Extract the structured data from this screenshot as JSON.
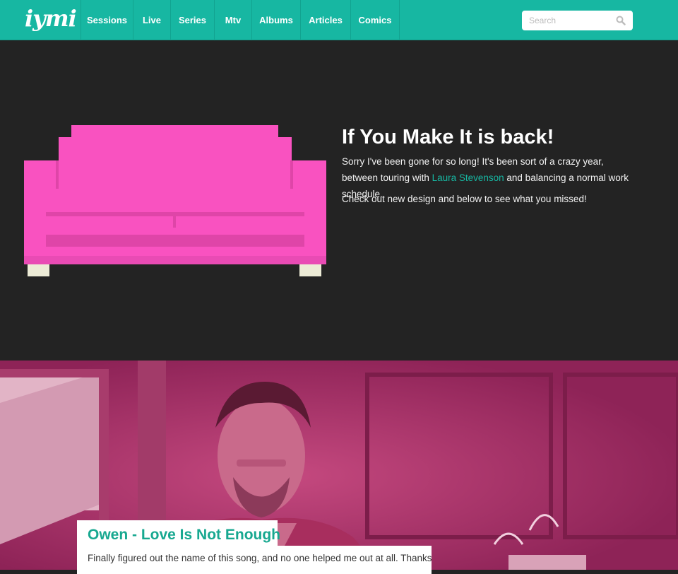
{
  "nav": {
    "logo": "iymi",
    "items": [
      {
        "label": "Sessions"
      },
      {
        "label": "Live"
      },
      {
        "label": "Series"
      },
      {
        "label": "Mtv"
      },
      {
        "label": "Albums"
      },
      {
        "label": "Articles"
      },
      {
        "label": "Comics"
      }
    ],
    "search_placeholder": "Search"
  },
  "hero": {
    "title": "If You Make It is back!",
    "p1_before": "Sorry I've been gone for so long! It's been sort of a crazy year, between touring with ",
    "p1_link": "Laura Stevenson",
    "p1_after": " and balancing a normal work schedule.",
    "p2": "Check out new design and below to see what you missed!"
  },
  "feature": {
    "title": "Owen - Love Is Not Enough",
    "description": "Finally figured out the name of this song, and no one helped me out at all. Thanks"
  },
  "colors": {
    "accent": "#17b7a2",
    "sofa": "#f952c0",
    "sofa_shade": "#df45a8",
    "hero_bg": "#232323",
    "feature_tint": "#b3356f"
  },
  "icons": [
    "search-icon",
    "sofa-illustration"
  ]
}
